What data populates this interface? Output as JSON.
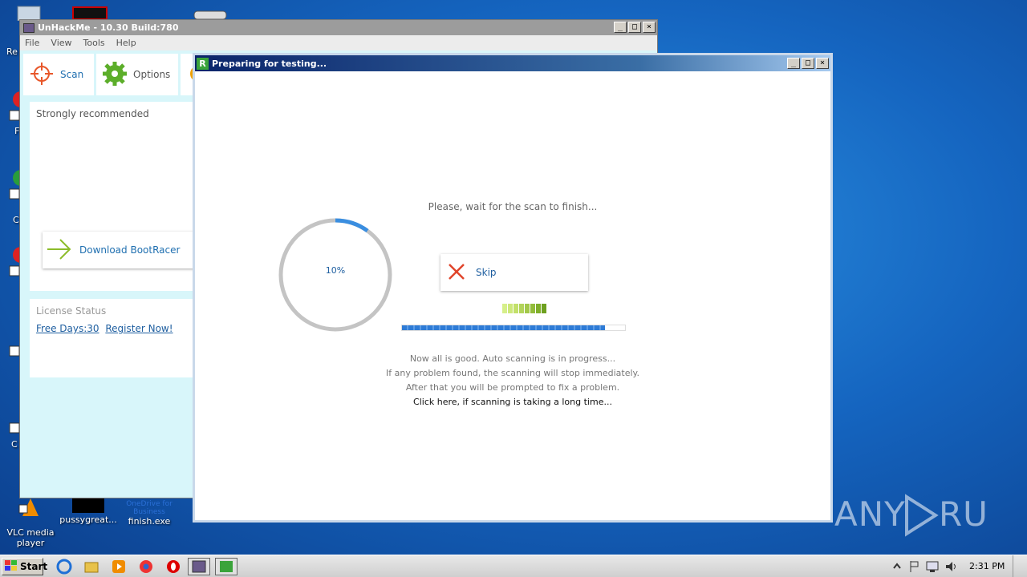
{
  "desktop": {
    "icons": [
      {
        "label": "VLC media player"
      },
      {
        "label": "pussygreat..."
      },
      {
        "label": "finish.exe",
        "badge": "OneDrive for Business"
      }
    ],
    "edge_labels": [
      "Re",
      "F",
      "C",
      "C"
    ]
  },
  "unhackme": {
    "title": "UnHackMe - 10.30 Build:780",
    "menu": [
      "File",
      "View",
      "Tools",
      "Help"
    ],
    "tabs": [
      {
        "label": "Scan"
      },
      {
        "label": "Options"
      }
    ],
    "recommended_heading": "Strongly recommended",
    "download_button": "Download BootRacer",
    "license_heading": "License Status",
    "free_days": "Free Days:30",
    "register": "Register Now!"
  },
  "scan_window": {
    "title": "Preparing for testing...",
    "wait_message": "Please, wait for the scan to finish...",
    "progress_label": "10%",
    "progress_fraction": 0.1,
    "bar_fraction": 0.91,
    "skip_label": "Skip",
    "info_lines": [
      "Now all is good. Auto scanning is in progress...",
      "If any problem found, the scanning will stop immediately.",
      "After that you will be prompted to fix a problem."
    ],
    "long_time_link": "Click here, if scanning is taking a long time..."
  },
  "watermark": {
    "text": "ANY RUN"
  },
  "taskbar": {
    "start_label": "Start",
    "clock": "2:31 PM"
  },
  "colors": {
    "accent_blue": "#1f5fa0",
    "progress_blue": "#2e7bd6",
    "ring_grey": "#c4c4c4",
    "skip_red": "#e0442a",
    "arrow_green": "#8cbc2a",
    "gear_green": "#5cae2a"
  }
}
